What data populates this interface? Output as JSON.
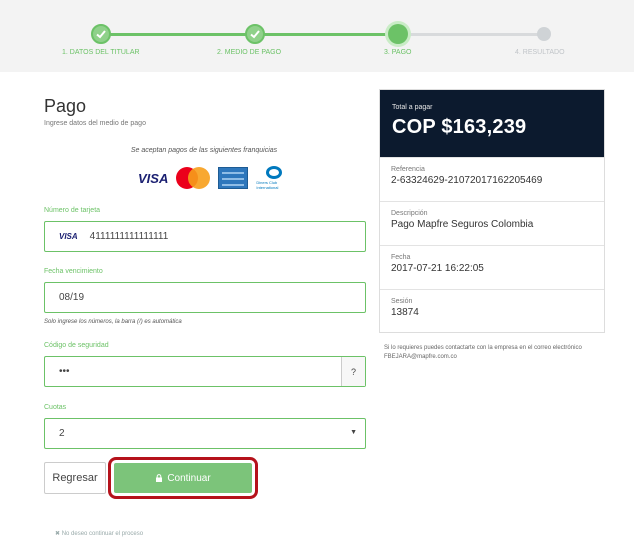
{
  "stepper": {
    "steps": [
      {
        "label": "1. DATOS DEL TITULAR",
        "state": "done"
      },
      {
        "label": "2. MEDIO DE PAGO",
        "state": "done"
      },
      {
        "label": "3. PAGO",
        "state": "current"
      },
      {
        "label": "4. RESULTADO",
        "state": "pending"
      }
    ],
    "colors": {
      "done": "#6cc267",
      "pending": "#cfd3d6"
    }
  },
  "form": {
    "title": "Pago",
    "subtitle": "Ingrese datos del medio de pago",
    "accept_text": "Se aceptan pagos de las siguientes franquicias",
    "card_brands": [
      "visa-logo",
      "mastercard-logo",
      "amex-logo",
      "diners-club-logo"
    ],
    "visa_text": "VISA",
    "diners_text": "Diners Club International",
    "card_number_label": "Número de tarjeta",
    "card_number_value": "4111111111111111",
    "expiry_label": "Fecha vencimiento",
    "expiry_value": "08/19",
    "expiry_hint": "Solo ingrese los números, la barra (/) es automática",
    "cvv_label": "Código de seguridad",
    "cvv_value": "•••",
    "cvv_help": "?",
    "installments_label": "Cuotas",
    "installments_value": "2",
    "back_label": "Regresar",
    "continue_label": "Continuar",
    "cancel_label": "✖ No deseo continuar el proceso",
    "accent_color": "#6cc267",
    "highlight_color": "#b5121b"
  },
  "summary": {
    "total_label": "Total a pagar",
    "total_value": "COP $163,239",
    "reference_label": "Referencia",
    "reference_value": "2-63324629-21072017162205469",
    "description_label": "Descripción",
    "description_value": "Pago Mapfre Seguros Colombia",
    "date_label": "Fecha",
    "date_value": "2017-07-21 16:22:05",
    "session_label": "Sesión",
    "session_value": "13874",
    "contact_text": "Si lo requieres puedes contactarte con la empresa en el correo electrónico FBEJARA@mapfre.com.co",
    "header_color": "#0c1a2e"
  }
}
